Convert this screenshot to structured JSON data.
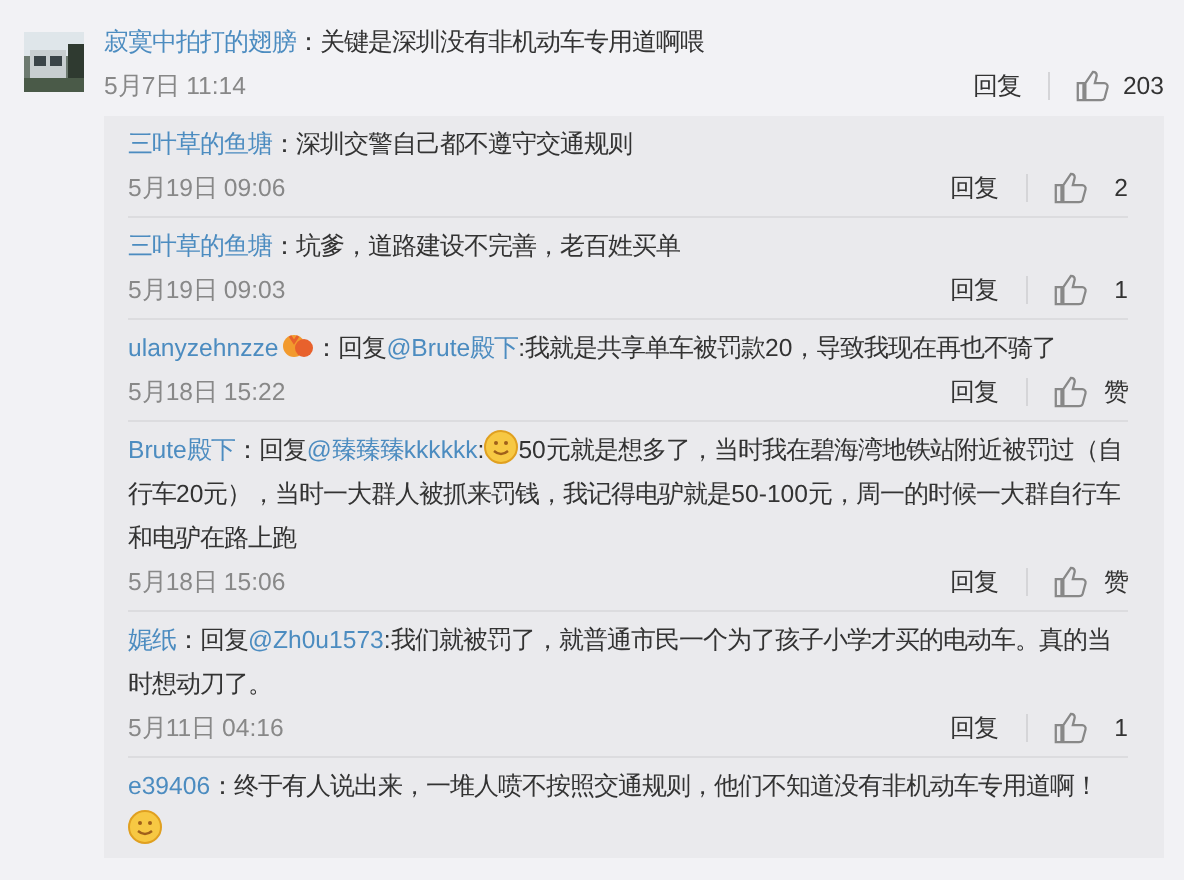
{
  "comment": {
    "user": "寂寞中拍打的翅膀",
    "text": "：关键是深圳没有非机动车专用道啊喂",
    "date": "5月7日 11:14",
    "reply_label": "回复",
    "likes": "203"
  },
  "replies": [
    {
      "segments": [
        {
          "kind": "user",
          "text": "三叶草的鱼塘"
        },
        {
          "kind": "text",
          "text": "：深圳交警自己都不遵守交通规则"
        }
      ],
      "date": "5月19日 09:06",
      "reply_label": "回复",
      "likes": "2"
    },
    {
      "segments": [
        {
          "kind": "user",
          "text": "三叶草的鱼塘"
        },
        {
          "kind": "text",
          "text": "：坑爹，道路建设不完善，老百姓买单"
        }
      ],
      "date": "5月19日 09:03",
      "reply_label": "回复",
      "likes": "1"
    },
    {
      "segments": [
        {
          "kind": "user",
          "text": "ulanyzehnzze"
        },
        {
          "kind": "badge"
        },
        {
          "kind": "text",
          "text": "：回复"
        },
        {
          "kind": "mention",
          "text": "@Brute殿下"
        },
        {
          "kind": "text",
          "text": ":我就是共享单车被罚款20，导致我现在再也不骑了"
        }
      ],
      "date": "5月18日 15:22",
      "reply_label": "回复",
      "likes": "赞"
    },
    {
      "segments": [
        {
          "kind": "user",
          "text": "Brute殿下"
        },
        {
          "kind": "text",
          "text": "：回复"
        },
        {
          "kind": "mention",
          "text": "@臻臻臻kkkkkk"
        },
        {
          "kind": "text",
          "text": ":"
        },
        {
          "kind": "emoji"
        },
        {
          "kind": "text",
          "text": "50元就是想多了，当时我在碧海湾地铁站附近被罚过（自行车20元），当时一大群人被抓来罚钱，我记得电驴就是50-100元，周一的时候一大群自行车和电驴在路上跑"
        }
      ],
      "date": "5月18日 15:06",
      "reply_label": "回复",
      "likes": "赞"
    },
    {
      "segments": [
        {
          "kind": "user",
          "text": "娓纸"
        },
        {
          "kind": "text",
          "text": "：回复"
        },
        {
          "kind": "mention",
          "text": "@Zh0u1573"
        },
        {
          "kind": "text",
          "text": ":我们就被罚了，就普通市民一个为了孩子小学才买的电动车。真的当时想动刀了。"
        }
      ],
      "date": "5月11日 04:16",
      "reply_label": "回复",
      "likes": "1"
    },
    {
      "segments": [
        {
          "kind": "user",
          "text": "e39406"
        },
        {
          "kind": "text",
          "text": "：终于有人说出来，一堆人喷不按照交通规则，他们不知道没有非机动车专用道啊！"
        },
        {
          "kind": "emoji"
        }
      ]
    }
  ]
}
